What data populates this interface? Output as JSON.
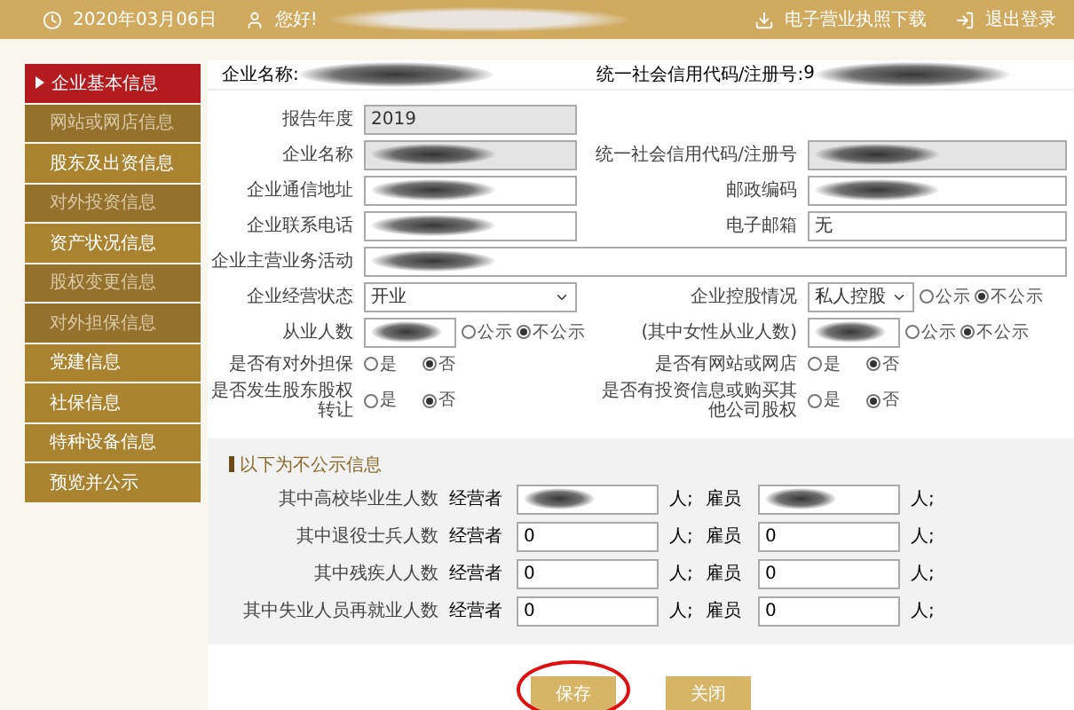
{
  "header": {
    "date": "2020年03月06日",
    "greeting": "您好!",
    "greeting_redacted": true,
    "links": [
      {
        "kind": "download",
        "label": "电子营业执照下载"
      },
      {
        "kind": "logout",
        "label": "退出登录"
      }
    ]
  },
  "sidebar": {
    "items": [
      {
        "label": "企业基本信息",
        "selected": true,
        "disabled": false
      },
      {
        "label": "网站或网店信息",
        "selected": false,
        "disabled": true
      },
      {
        "label": "股东及出资信息",
        "selected": false,
        "disabled": false
      },
      {
        "label": "对外投资信息",
        "selected": false,
        "disabled": true
      },
      {
        "label": "资产状况信息",
        "selected": false,
        "disabled": false
      },
      {
        "label": "股权变更信息",
        "selected": false,
        "disabled": true
      },
      {
        "label": "对外担保信息",
        "selected": false,
        "disabled": true
      },
      {
        "label": "党建信息",
        "selected": false,
        "disabled": false
      },
      {
        "label": "社保信息",
        "selected": false,
        "disabled": false
      },
      {
        "label": "特种设备信息",
        "selected": false,
        "disabled": false
      },
      {
        "label": "预览并公示",
        "selected": false,
        "disabled": false
      }
    ]
  },
  "summary": [
    {
      "label": "企业名称:",
      "redacted": true
    },
    {
      "label": "统一社会信用代码/注册号:",
      "value": "9",
      "redacted": true
    }
  ],
  "form": {
    "rows": [
      [
        {
          "label": "报告年度",
          "kind": "text",
          "value": "2019",
          "readonly": true
        }
      ],
      [
        {
          "label": "企业名称",
          "kind": "text",
          "readonly": true,
          "redacted": true
        },
        {
          "label": "统一社会信用代码/注册号",
          "kind": "text",
          "readonly": true,
          "redacted": true
        }
      ],
      [
        {
          "label": "企业通信地址",
          "kind": "text",
          "readonly": false,
          "redacted": true
        },
        {
          "label": "邮政编码",
          "kind": "text",
          "readonly": false,
          "redacted": true
        }
      ],
      [
        {
          "label": "企业联系电话",
          "kind": "text",
          "readonly": false,
          "redacted": true
        },
        {
          "label": "电子邮箱",
          "kind": "text",
          "value": "无",
          "readonly": false
        }
      ],
      [
        {
          "label": "企业主营业务活动",
          "kind": "wide",
          "readonly": false,
          "redacted": true
        }
      ],
      [
        {
          "label": "企业经营状态",
          "kind": "select",
          "value": "开业"
        },
        {
          "label": "企业控股情况",
          "kind": "select",
          "value": "私人控股",
          "options": [
            {
              "label": "公示",
              "selected": false
            },
            {
              "label": "不公示",
              "selected": true
            }
          ]
        }
      ],
      [
        {
          "label": "从业人数",
          "kind": "text",
          "readonly": false,
          "redacted": true,
          "options": [
            {
              "label": "公示",
              "selected": false
            },
            {
              "label": "不公示",
              "selected": true
            }
          ]
        },
        {
          "label": "(其中女性从业人数)",
          "kind": "text",
          "readonly": false,
          "redacted": true,
          "options": [
            {
              "label": "公示",
              "selected": false
            },
            {
              "label": "不公示",
              "selected": true
            }
          ]
        }
      ],
      [
        {
          "label": "是否有对外担保",
          "kind": "radio",
          "options": [
            {
              "label": "是",
              "selected": false
            },
            {
              "label": "否",
              "selected": true
            }
          ]
        },
        {
          "label": "是否有网站或网店",
          "kind": "radio",
          "options": [
            {
              "label": "是",
              "selected": false
            },
            {
              "label": "否",
              "selected": true
            }
          ]
        }
      ],
      [
        {
          "label": "是否发生股东股权转让",
          "kind": "radio",
          "options": [
            {
              "label": "是",
              "selected": false
            },
            {
              "label": "否",
              "selected": true
            }
          ]
        },
        {
          "label": "是否有投资信息或购买其他公司股权",
          "kind": "radio",
          "options": [
            {
              "label": "是",
              "selected": false
            },
            {
              "label": "否",
              "selected": true
            }
          ]
        }
      ]
    ]
  },
  "private_section": {
    "title": "以下为不公示信息",
    "rows": [
      {
        "label": "其中高校毕业生人数",
        "items": [
          {
            "role": "经营者",
            "redacted": true,
            "unit": "人;"
          },
          {
            "role": "雇员",
            "redacted": true,
            "unit": "人;"
          }
        ]
      },
      {
        "label": "其中退役士兵人数",
        "items": [
          {
            "role": "经营者",
            "value": "0",
            "unit": "人;"
          },
          {
            "role": "雇员",
            "value": "0",
            "unit": "人;"
          }
        ]
      },
      {
        "label": "其中残疾人人数",
        "items": [
          {
            "role": "经营者",
            "value": "0",
            "unit": "人;"
          },
          {
            "role": "雇员",
            "value": "0",
            "unit": "人;"
          }
        ]
      },
      {
        "label": "其中失业人员再就业人数",
        "items": [
          {
            "role": "经营者",
            "value": "0",
            "unit": "人;"
          },
          {
            "role": "雇员",
            "value": "0",
            "unit": "人;"
          }
        ]
      }
    ]
  },
  "buttons": [
    {
      "label": "保存",
      "circled": true
    },
    {
      "label": "关闭",
      "circled": false
    }
  ]
}
